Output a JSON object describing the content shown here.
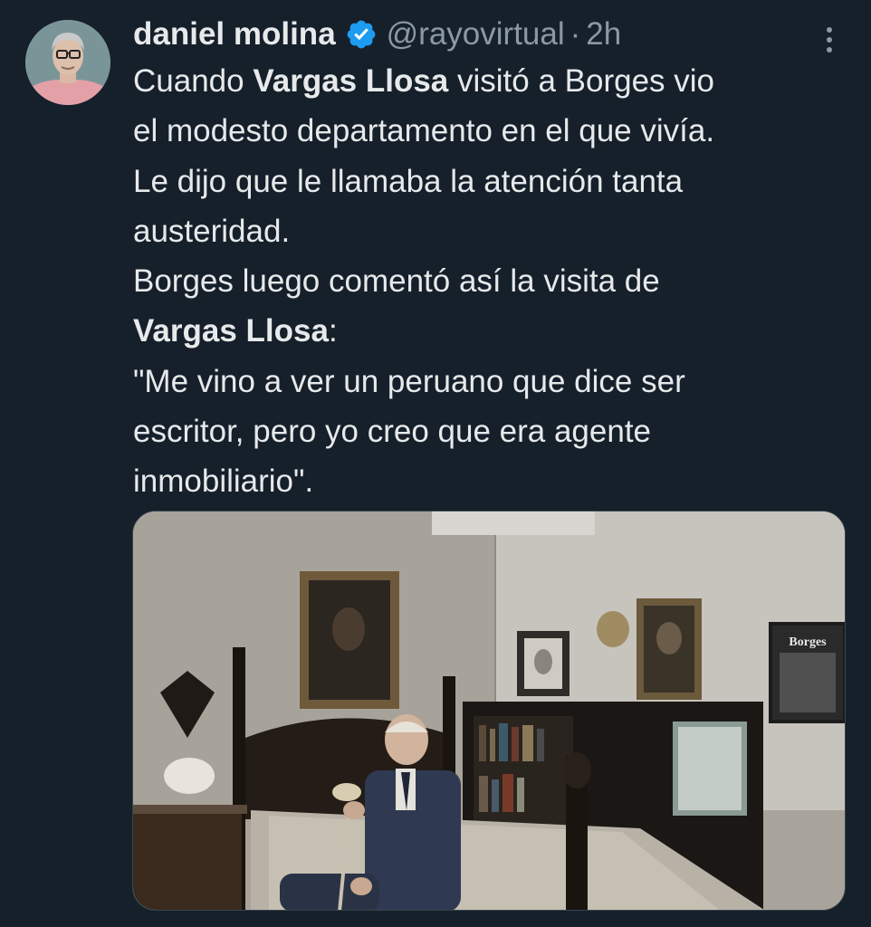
{
  "tweet": {
    "author": {
      "display_name": "daniel molina",
      "verified": true,
      "verified_icon": "verified-badge-icon",
      "handle": "@rayovirtual",
      "separator": "·",
      "timestamp": "2h"
    },
    "more_icon": "more-options-icon",
    "text": {
      "l1_a": "Cuando ",
      "l1_b": "Vargas Llosa",
      "l1_c": " visitó a Borges vio",
      "l2": "el modesto departamento en el que vivía.",
      "l3": "Le dijo que le llamaba la atención tanta",
      "l4": "austeridad.",
      "l5": "Borges luego comentó así la visita de",
      "l6_a": "Vargas Llosa",
      "l6_b": ":",
      "l7": "\"Me vino a ver un peruano que dice ser",
      "l8": "escritor, pero yo creo que era agente",
      "l9": "inmobiliario\"."
    },
    "media": {
      "poster_text": "Borges"
    }
  },
  "colors": {
    "background": "#15202b",
    "text_primary": "#e7e9ea",
    "text_secondary": "#8b98a5",
    "verified": "#1d9bf0"
  }
}
